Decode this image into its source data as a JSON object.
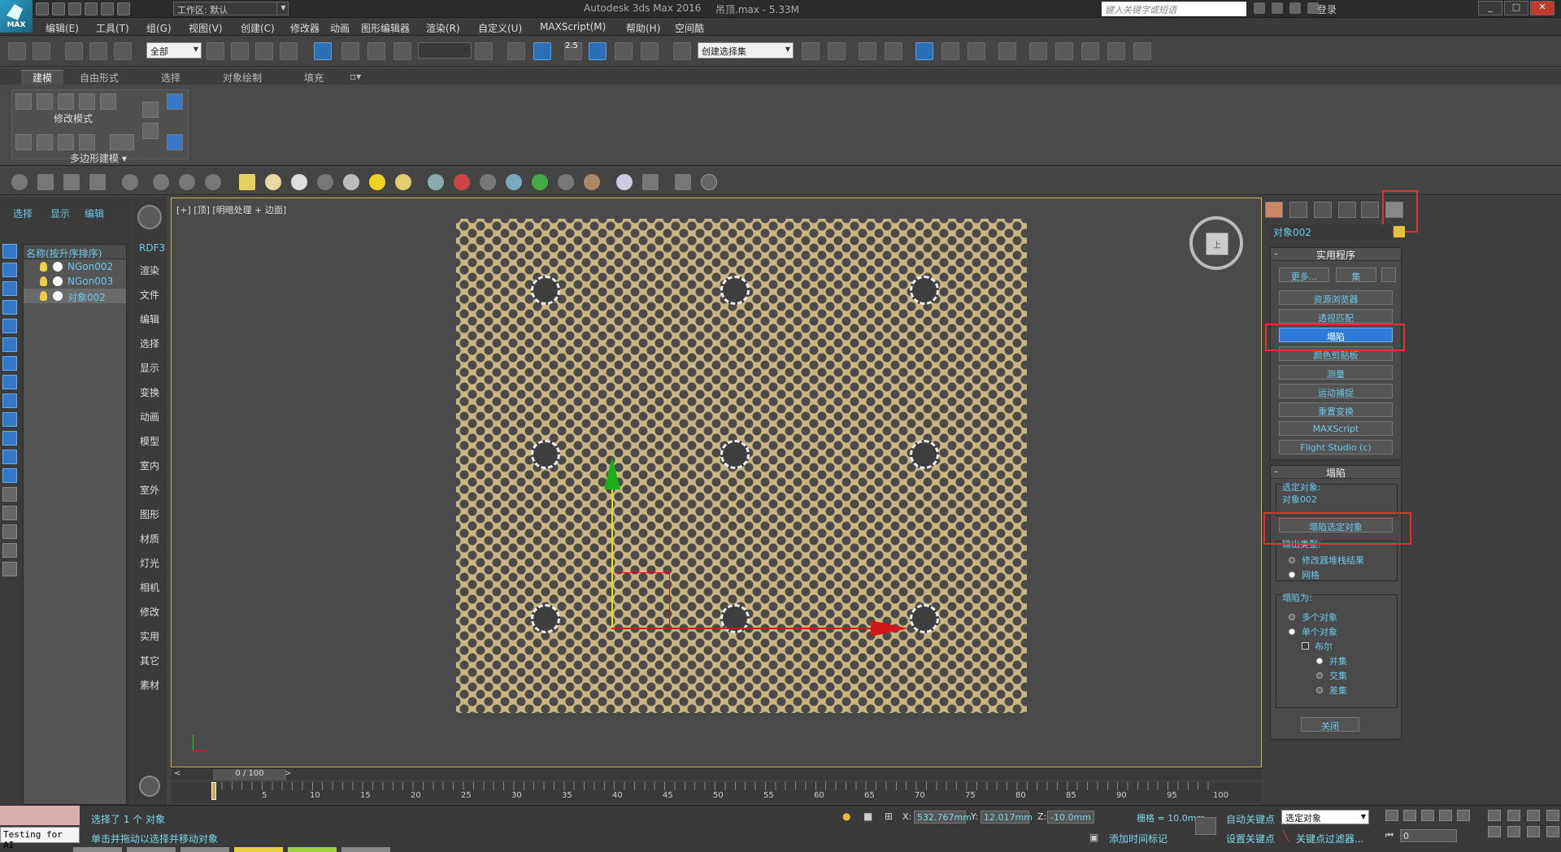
{
  "titlebar": {
    "app_logo": "MAX",
    "workspace": "工作区: 默认",
    "app_title": "Autodesk 3ds Max 2016",
    "doc_title": "吊顶.max - 5.33M",
    "search_placeholder": "键入关键字或短语",
    "login": "登录"
  },
  "menu": [
    "编辑(E)",
    "工具(T)",
    "组(G)",
    "视图(V)",
    "创建(C)",
    "修改器",
    "动画",
    "图形编辑器",
    "渲染(R)",
    "自定义(U)",
    "MAXScript(M)",
    "帮助(H)",
    "空间酷"
  ],
  "toolbar": {
    "filter_combo": "全部",
    "selection_set": "创建选择集",
    "snap_value": "2.5"
  },
  "ribbon": {
    "tabs": [
      "建模",
      "自由形式",
      "选择",
      "对象绘制",
      "填充"
    ],
    "active_tab": "建模",
    "mode_label": "修改模式",
    "poly_label": "多边形建模 ▾"
  },
  "scene_explorer": {
    "tabs": [
      "选择",
      "显示",
      "编辑"
    ],
    "header": "名称(按升序排序)",
    "items": [
      {
        "name": "NGon002"
      },
      {
        "name": "NGon003"
      },
      {
        "name": "对象002",
        "selected": true
      }
    ]
  },
  "command_column": [
    "RDF3",
    "渲染",
    "文件",
    "编辑",
    "选择",
    "显示",
    "变换",
    "动画",
    "模型",
    "室内",
    "室外",
    "图形",
    "材质",
    "灯光",
    "相机",
    "修改",
    "实用",
    "其它",
    "素材"
  ],
  "viewport": {
    "label": "[+] [顶] [明暗处理 + 边面]",
    "viewcube_face": "上"
  },
  "panel": {
    "object_name": "对象002",
    "utilities_title": "实用程序",
    "more_button": "更多...",
    "sets_button": "集",
    "utility_buttons": [
      "资源浏览器",
      "透视匹配",
      "塌陷",
      "颜色剪贴板",
      "测量",
      "运动捕捉",
      "重置变换",
      "MAXScript",
      "Flight Studio (c)"
    ],
    "active_utility": "塌陷",
    "collapse_title": "塌陷",
    "selected_label": "选定对象:",
    "selected_value": "对象002",
    "collapse_selected_button": "塌陷选定对象",
    "output_type_label": "输出类型:",
    "output_options": [
      "修改器堆栈结果",
      "网格"
    ],
    "output_selected": "网格",
    "collapse_to_label": "塌陷为:",
    "collapse_to_options": [
      "多个对象",
      "单个对象"
    ],
    "collapse_to_selected": "单个对象",
    "boolean_label": "布尔",
    "boolean_ops": [
      "并集",
      "交集",
      "差集"
    ],
    "boolean_selected": "并集",
    "close_button": "关闭"
  },
  "timeline": {
    "frame_display": "0 / 100",
    "ticks": [
      "5",
      "10",
      "15",
      "20",
      "25",
      "30",
      "35",
      "40",
      "45",
      "50",
      "55",
      "60",
      "65",
      "70",
      "75",
      "80",
      "85",
      "90",
      "95",
      "100"
    ]
  },
  "status": {
    "testing": "Testing for AI",
    "line1": "选择了 1 个 对象",
    "line2": "单击并拖动以选择并移动对象",
    "x_label": "X:",
    "x_value": "532.767mm",
    "y_label": "Y:",
    "y_value": "12.017mm",
    "z_label": "Z:",
    "z_value": "-10.0mm",
    "grid": "栅格 = 10.0mm",
    "add_time_tag": "添加时间标记",
    "auto_key": "自动关键点",
    "set_key": "设置关键点",
    "key_filter": "关键点过滤器...",
    "selection_combo": "选定对象",
    "frame_value": "0"
  }
}
